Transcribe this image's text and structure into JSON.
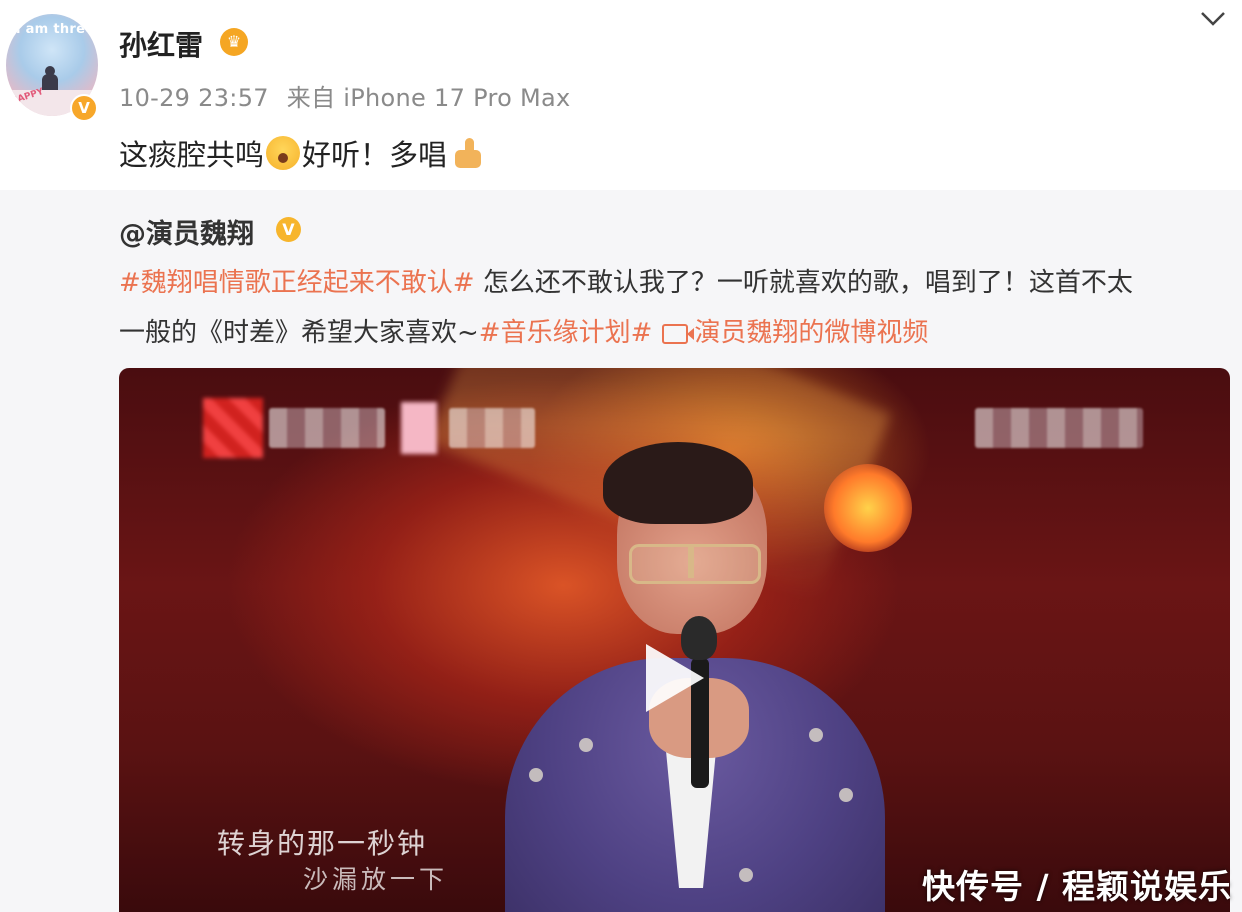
{
  "post": {
    "username": "孙红雷",
    "avatar_text": "i am three",
    "avatar_badge_text": "HAPPY",
    "verified_badge": "V",
    "time": "10-29 23:57",
    "source": "来自 iPhone 17 Pro Max",
    "text_part1": "这痰腔共鸣",
    "text_part2": "好听！多唱",
    "emoji_1": "scream-face-icon",
    "emoji_2": "thumbs-up-icon"
  },
  "repost": {
    "mention": "@演员魏翔",
    "badge": "V",
    "hashtag1": "#魏翔唱情歌正经起来不敢认#",
    "line1_text": " 怎么还不敢认我了？一听就喜欢的歌，唱到了！这首不太",
    "line2_text": "一般的《时差》希望大家喜欢~",
    "hashtag2": "#音乐缘计划#",
    "video_link": "演员魏翔的微博视频"
  },
  "video": {
    "lyric_line1": "转身的那一秒钟",
    "lyric_line2": "沙漏放一下"
  },
  "watermark": "快传号 / 程颖说娱乐",
  "colors": {
    "hashtag": "#eb7350",
    "verified": "#f7a72a",
    "meta_gray": "#8a8a8a"
  }
}
